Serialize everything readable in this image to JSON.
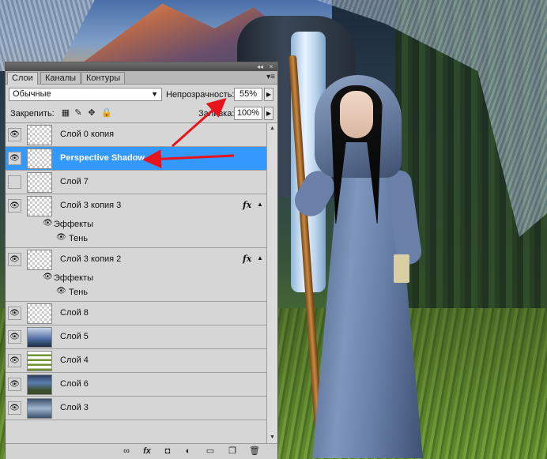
{
  "panel": {
    "tabs": [
      {
        "label": "Слои",
        "active": true
      },
      {
        "label": "Каналы",
        "active": false
      },
      {
        "label": "Контуры",
        "active": false
      }
    ],
    "titlebar": {
      "collapse_icon": "◂◂",
      "close_icon": "×"
    },
    "menu_icon": "▾≡",
    "blend_mode": "Обычные",
    "opacity_label": "Непрозрачность:",
    "opacity_value": "55%",
    "lock_label": "Закрепить:",
    "fill_label": "Заливка:",
    "fill_value": "100%",
    "layers": [
      {
        "name": "Слой 0 копия",
        "visible": true,
        "selected": false
      },
      {
        "name": "Perspective Shadow",
        "visible": true,
        "selected": true
      },
      {
        "name": "Слой 7",
        "visible": false,
        "selected": false
      },
      {
        "name": "Слой 3 копия 3",
        "visible": true,
        "selected": false,
        "fx": "fx",
        "effects_label": "Эффекты",
        "effect_name": "Тень"
      },
      {
        "name": "Слой 3 копия 2",
        "visible": true,
        "selected": false,
        "fx": "fx",
        "effects_label": "Эффекты",
        "effect_name": "Тень"
      },
      {
        "name": "Слой 8",
        "visible": true,
        "selected": false
      },
      {
        "name": "Слой 5",
        "visible": true,
        "selected": false
      },
      {
        "name": "Слой 4",
        "visible": true,
        "selected": false
      },
      {
        "name": "Слой 6",
        "visible": true,
        "selected": false
      },
      {
        "name": "Слой 3",
        "visible": true,
        "selected": false
      }
    ]
  },
  "colors": {
    "selection": "#3399ff",
    "arrow": "#e8141b",
    "panel_bg": "#d6d6d6"
  }
}
